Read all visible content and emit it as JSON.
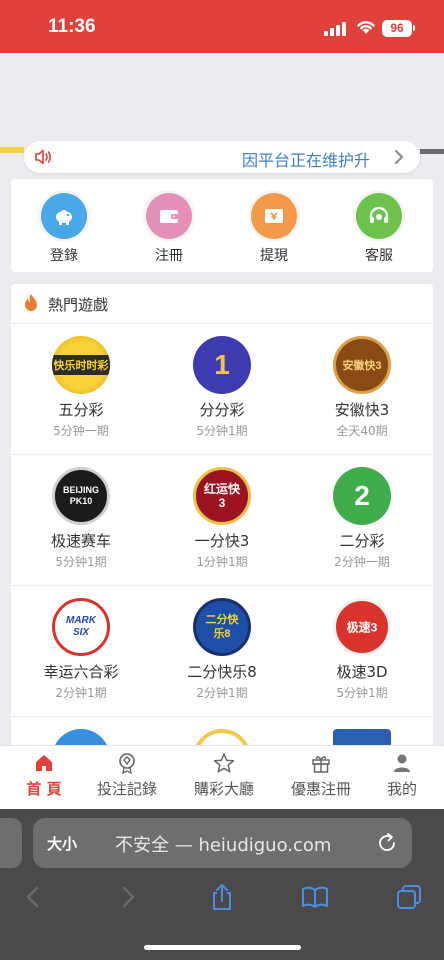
{
  "status": {
    "time": "11:36",
    "battery": "96"
  },
  "notice": {
    "text": "因平台正在维护升"
  },
  "quick_actions": [
    {
      "label": "登錄",
      "color": "#4aa8e8",
      "icon": "piggy-bank-icon"
    },
    {
      "label": "注冊",
      "color": "#e38fb7",
      "icon": "wallet-icon"
    },
    {
      "label": "提現",
      "color": "#f29a4a",
      "icon": "withdraw-ticket-icon"
    },
    {
      "label": "客服",
      "color": "#6cc24a",
      "icon": "headset-icon"
    }
  ],
  "games": {
    "title": "熱門遊戲",
    "items": [
      {
        "name": "五分彩",
        "sub": "5分钟一期",
        "logo": "快乐时时彩"
      },
      {
        "name": "分分彩",
        "sub": "5分钟1期",
        "logo": "1"
      },
      {
        "name": "安徽快3",
        "sub": "全天40期",
        "logo": "安徽快3"
      },
      {
        "name": "极速赛车",
        "sub": "5分钟1期",
        "logo": "BEIJING PK10"
      },
      {
        "name": "一分快3",
        "sub": "1分钟1期",
        "logo": "红运快3"
      },
      {
        "name": "二分彩",
        "sub": "2分钟一期",
        "logo": "2"
      },
      {
        "name": "幸运六合彩",
        "sub": "2分钟1期",
        "logo": "MARK SIX"
      },
      {
        "name": "二分快乐8",
        "sub": "2分钟1期",
        "logo": "二分快乐8"
      },
      {
        "name": "极速3D",
        "sub": "5分钟1期",
        "logo": "极速3"
      }
    ]
  },
  "tabbar": [
    {
      "label": "首 頁",
      "active": true,
      "icon": "home-icon"
    },
    {
      "label": "投注記錄",
      "active": false,
      "icon": "trophy-icon"
    },
    {
      "label": "購彩大廳",
      "active": false,
      "icon": "star-icon"
    },
    {
      "label": "優惠注冊",
      "active": false,
      "icon": "gift-icon"
    },
    {
      "label": "我的",
      "active": false,
      "icon": "user-icon"
    }
  ],
  "browser": {
    "text_size": "大小",
    "url": "不安全 — heiudiguo.com"
  },
  "colors": {
    "brand": "#e0423b",
    "notice_text": "#3a7fc4"
  }
}
